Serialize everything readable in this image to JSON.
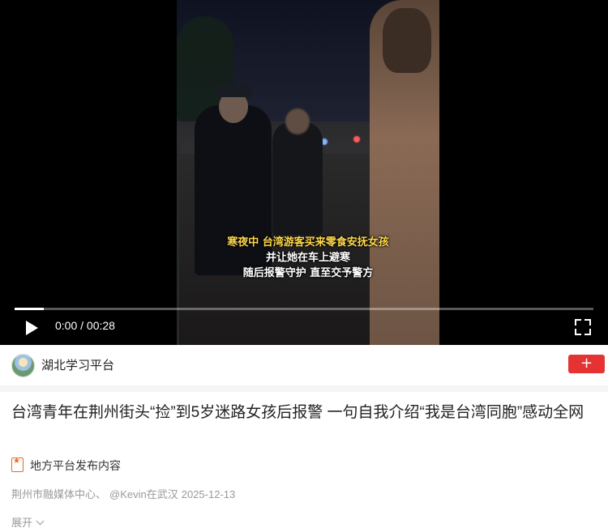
{
  "video": {
    "caption_lines": [
      "寒夜中 台湾游客买来零食安抚女孩",
      "并让她在车上避寒",
      "随后报警守护 直至交予警方"
    ],
    "current_time": "0:00",
    "separator": " / ",
    "duration": "00:28",
    "progress_fraction": 0.05
  },
  "author": {
    "name": "湖北学习平台",
    "follow_label": "+"
  },
  "article": {
    "title": "台湾青年在荆州街头“捡”到5岁迷路女孩后报警 一句自我介绍“我是台湾同胞”感动全网",
    "tag": "地方平台发布内容",
    "source_1": "荆州市融媒体中心、",
    "source_2": "@Kevin在武汉",
    "date": "2025-12-13",
    "expand_label": "展开"
  },
  "colors": {
    "follow_button": "#e53333",
    "caption_text": "#ffd84a",
    "tag_icon": "#e86a2a"
  }
}
